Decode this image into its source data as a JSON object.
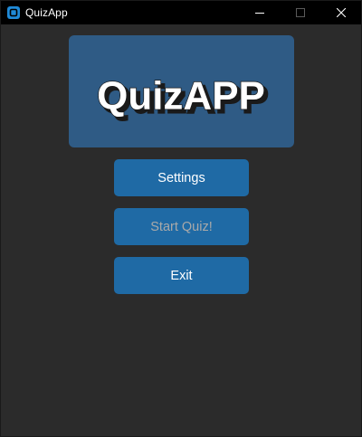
{
  "window": {
    "title": "QuizApp",
    "app_icon": "app-logo-icon",
    "controls": [
      "minimize-icon",
      "maximize-icon",
      "close-icon"
    ]
  },
  "logo": {
    "text": "QuizAPP"
  },
  "menu": {
    "settings_label": "Settings",
    "start_label": "Start Quiz!",
    "start_enabled": false,
    "exit_label": "Exit"
  },
  "colors": {
    "background": "#2b2b2b",
    "titlebar": "#000000",
    "logo_box": "#2f5b85",
    "button": "#1f6aa5",
    "button_text": "#ffffff",
    "button_text_disabled": "#a9a9a9"
  }
}
